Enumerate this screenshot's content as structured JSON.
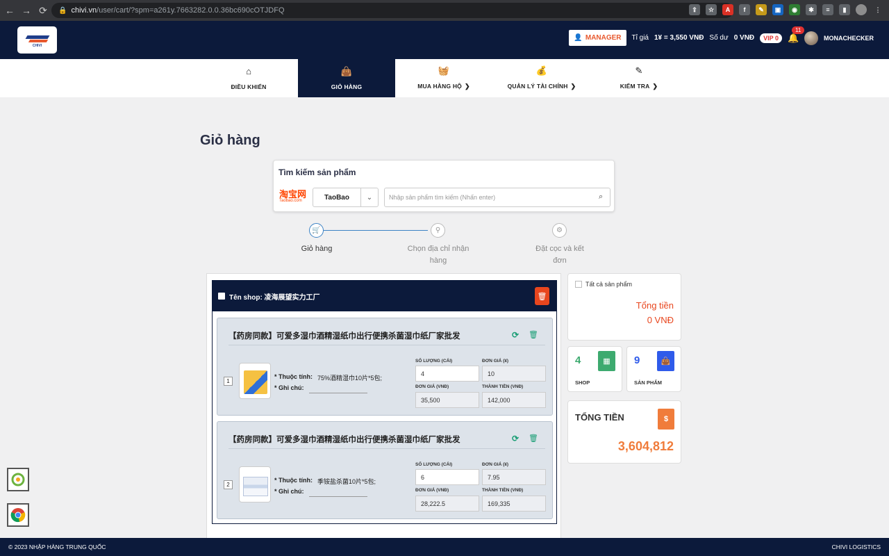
{
  "browser": {
    "url_domain": "chivi.vn",
    "url_path": "/user/cart/?spm=a261y.7663282.0.0.36bc690cOTJDFQ"
  },
  "header": {
    "manager_label": "MANAGER",
    "rate_label": "Tỉ giá",
    "rate_value": "1¥ = 3,550 VNĐ",
    "balance_label": "Số dư",
    "balance_value": "0 VNĐ",
    "vip_label": "VIP 0",
    "notification_count": "11",
    "username": "MONACHECKER"
  },
  "nav": {
    "items": [
      {
        "label": "ĐIỀU KHIỂN",
        "icon": "home-icon"
      },
      {
        "label": "GIỎ HÀNG",
        "icon": "bag-icon"
      },
      {
        "label": "MUA HÀNG HỘ",
        "icon": "basket-icon"
      },
      {
        "label": "QUẢN LÝ TÀI CHÍNH",
        "icon": "money-bag-icon"
      },
      {
        "label": "KIỂM TRA",
        "icon": "edit-icon"
      }
    ]
  },
  "page": {
    "title": "Giỏ hàng"
  },
  "search": {
    "title": "Tìm kiếm sản phẩm",
    "logo_zh": "淘宝网",
    "logo_en": "Taobao.com",
    "site_value": "TaoBao",
    "placeholder": "Nhập sản phẩm tìm kiếm (Nhấn enter)"
  },
  "steps": [
    {
      "label": "Giỏ hàng"
    },
    {
      "label": "Chọn địa chỉ nhận hàng"
    },
    {
      "label": "Đặt cọc và kết đơn"
    }
  ],
  "cart": {
    "shop_name": "Tên shop: 凌海展望实力工厂",
    "field_labels": {
      "quantity": "SỐ LƯỢNG (CÁI)",
      "unit_price_cny": "ĐƠN GIÁ (¥)",
      "unit_price_vnd": "ĐƠN GIÁ (VNĐ)",
      "total_vnd": "THÀNH TIỀN (VNĐ)",
      "attribute": "* Thuộc tính:",
      "note": "* Ghi chú:"
    },
    "items": [
      {
        "index": "1",
        "title": "【药房同款】可爱多湿巾酒精湿纸巾出行便携杀菌湿巾纸厂家批发",
        "attribute": "75%酒精湿巾10片*5包;",
        "quantity": "4",
        "unit_price_cny": "10",
        "unit_price_vnd": "35,500",
        "total_vnd": "142,000"
      },
      {
        "index": "2",
        "title": "【药房同款】可爱多湿巾酒精湿纸巾出行便携杀菌湿巾纸厂家批发",
        "attribute": "季铵盐杀菌10片*5包;",
        "quantity": "6",
        "unit_price_cny": "7.95",
        "unit_price_vnd": "28,222.5",
        "total_vnd": "169,335"
      }
    ]
  },
  "summary": {
    "select_all_label": "Tất cả sản phẩm",
    "total_label": "Tổng tiền",
    "total_value": "0 VNĐ",
    "shop_count": "4",
    "shop_label": "SHOP",
    "product_count": "9",
    "product_label": "SẢN PHẨM",
    "grand_total_label": "TỔNG TIỀN",
    "grand_total_value": "3,604,812"
  },
  "footer": {
    "left": "© 2023 NHẬP HÀNG TRUNG QUỐC",
    "right": "CHIVI LOGISTICS"
  },
  "colors": {
    "navy": "#0c1a3b",
    "accent_orange": "#e8461e",
    "total_orange": "#f07c3b",
    "shop_green": "#3daa6f",
    "product_blue": "#2f5bea",
    "step_blue": "#3b82c4"
  }
}
